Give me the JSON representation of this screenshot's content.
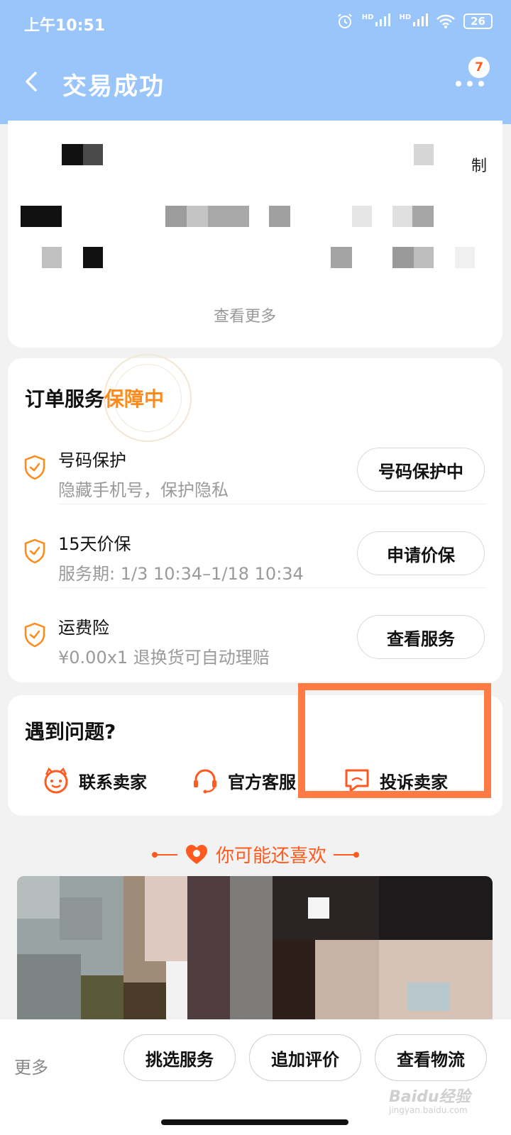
{
  "status_bar": {
    "time": "上午10:51",
    "hd1": "HD",
    "hd2": "HD",
    "battery": "26"
  },
  "header": {
    "title": "交易成功",
    "badge_count": "7"
  },
  "blur_card": {
    "mark": "制",
    "see_more": "查看更多"
  },
  "service": {
    "title_prefix": "订单服务",
    "title_status": "保障中",
    "items": [
      {
        "name": "号码保护",
        "desc": "隐藏手机号，保护隐私",
        "action": "号码保护中"
      },
      {
        "name": "15天价保",
        "desc": "服务期: 1/3 10:34–1/18 10:34",
        "action": "申请价保"
      },
      {
        "name": "运费险",
        "desc": "¥0.00x1 退换货可自动理赔",
        "action": "查看服务"
      }
    ]
  },
  "problem": {
    "title": "遇到问题?",
    "items": [
      {
        "label": "联系卖家",
        "icon": "smile-face-icon"
      },
      {
        "label": "官方客服",
        "icon": "headset-icon"
      },
      {
        "label": "投诉卖家",
        "icon": "complaint-chat-icon"
      }
    ]
  },
  "recommend": {
    "title": "你可能还喜欢"
  },
  "bottom_bar": {
    "more": "更多",
    "buttons": [
      "挑选服务",
      "追加评价",
      "查看物流"
    ]
  },
  "watermark": {
    "brand": "Baidu经验",
    "url": "jingyan.baidu.com"
  },
  "colors": {
    "header_bg": "#99c5fb",
    "accent": "#ff8a1a",
    "highlight": "#ff7a45"
  }
}
